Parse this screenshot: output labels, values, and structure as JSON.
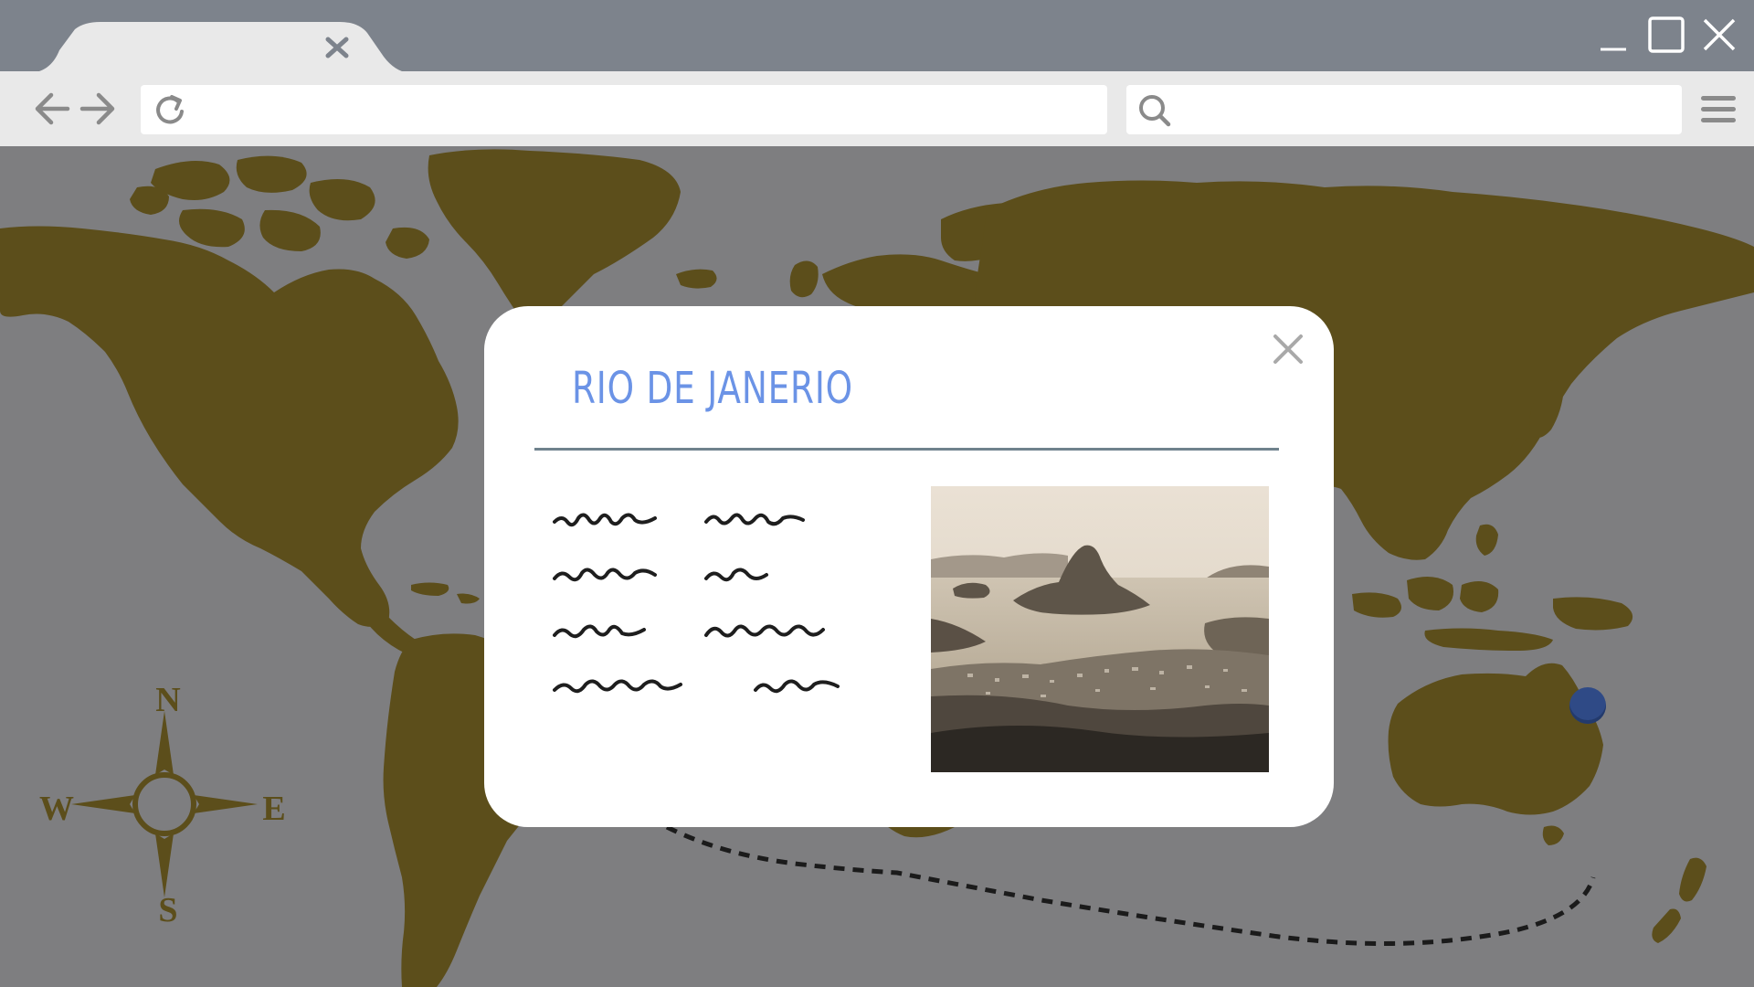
{
  "browser": {
    "tab": {
      "close_icon": "tab-close-icon"
    },
    "window_controls": [
      "minimize-icon",
      "maximize-icon",
      "window-close-icon"
    ],
    "nav": {
      "back_icon": "arrow-left-icon",
      "forward_icon": "arrow-right-icon",
      "reload_icon": "reload-icon"
    },
    "address_bar": {
      "value": "",
      "placeholder": ""
    },
    "search_bar": {
      "value": "",
      "placeholder": "",
      "icon": "search-icon"
    },
    "menu_icon": "hamburger-menu-icon"
  },
  "map": {
    "compass": {
      "north": "N",
      "south": "S",
      "west": "W",
      "east": "E"
    },
    "route_pins": [
      "location-pin",
      "location-pin"
    ],
    "colors": {
      "land": "#5c4e1b",
      "ocean": "#7e7e80",
      "pin": "#2f4a86",
      "route": "#1b1b1b"
    }
  },
  "popup": {
    "title": "RIO DE JANERIO",
    "close_icon": "close-icon",
    "title_color": "#6b93e6",
    "photo": "sepia-city-bay-photo"
  }
}
